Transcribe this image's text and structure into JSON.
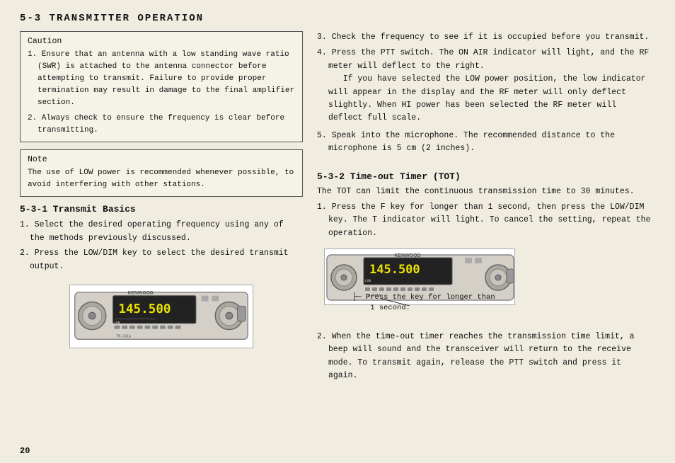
{
  "page": {
    "title": "5-3    TRANSMITTER OPERATION",
    "page_number": "20"
  },
  "left": {
    "caution_title": "Caution",
    "caution_items": [
      "1. Ensure that an antenna with a low standing wave ratio (SWR) is attached to the antenna connector before attempting to transmit. Failure to provide proper termination may result in damage to the final amplifier section.",
      "2. Always check to ensure the frequency is clear before transmitting."
    ],
    "note_title": "Note",
    "note_text": "The use of LOW power is recommended whenever possible, to avoid interfering with other stations.",
    "section531_title": "5-3-1    Transmit Basics",
    "section531_items": [
      "1. Select the desired operating frequency  using any of the methods previously discussed.",
      "2. Press the LOW/DIM key to select the desired transmit output."
    ]
  },
  "right": {
    "items_345": [
      "3. Check the frequency to see if it is occupied before you transmit.",
      "4. Press the PTT switch. The ON AIR indicator will light, and the RF meter will deflect to the right.\n   If you have selected the LOW power position, the low indicator will appear in the display and the RF meter will only deflect slightly. When HI power has been selected the RF meter will deflect full scale.",
      "5. Speak into the microphone. The recommended distance to the microphone is 5 cm (2 inches)."
    ],
    "section532_title": "5-3-2    Time-out Timer (TOT)",
    "section532_intro": "The TOT can limit the continuous transmission time to 30 minutes.",
    "section532_items": [
      "1. Press the F key for longer than 1 second, then press the LOW/DIM key. The T indicator will light. To cancel the setting, repeat the operation.",
      "2. When the time-out timer reaches the transmission time limit, a beep will sound and the transceiver will return to the receive mode. To transmit again, release the PTT switch and press it again."
    ],
    "callout_text": "Press the key for longer than\n1 second."
  }
}
